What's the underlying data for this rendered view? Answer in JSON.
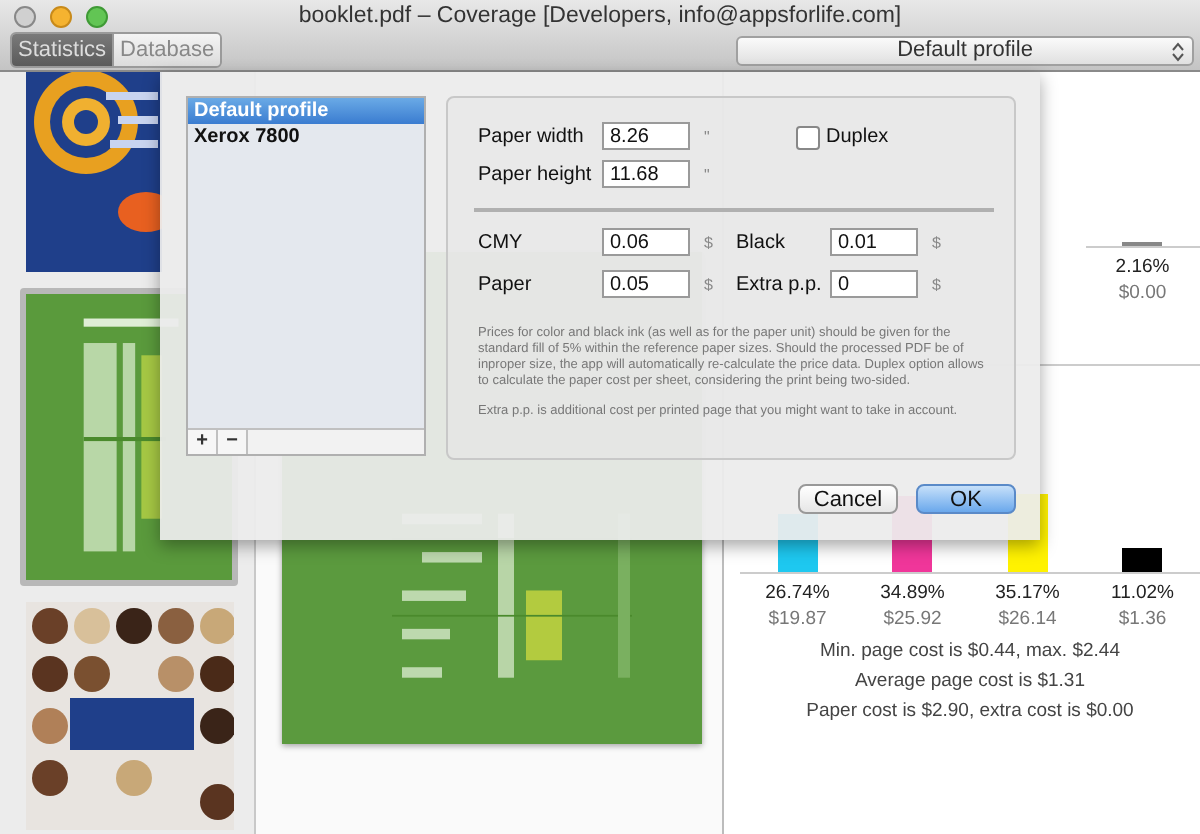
{
  "window": {
    "title": "booklet.pdf – Coverage [Developers, info@appsforlife.com]"
  },
  "view_tabs": [
    {
      "label": "Statistics",
      "selected": true
    },
    {
      "label": "Database",
      "selected": false
    }
  ],
  "profile_popup": {
    "value": "Default profile"
  },
  "page_cost_column": {
    "share": "2.16%",
    "cost": "$0.00",
    "level": 0.0216
  },
  "inks": [
    {
      "color": "#1ec8f0",
      "share": "26.74%",
      "cost": "$19.87",
      "level": 0.2674
    },
    {
      "color": "#f0369a",
      "share": "34.89%",
      "cost": "$25.92",
      "level": 0.3489
    },
    {
      "color": "#fff200",
      "share": "35.17%",
      "cost": "$26.14",
      "level": 0.3517
    },
    {
      "color": "#000000",
      "share": "11.02%",
      "cost": "$1.36",
      "level": 0.1102
    }
  ],
  "summary_lines": [
    "Min. page cost is $0.44, max. $2.44",
    "Average page cost is $1.31",
    "Paper cost is $2.90, extra cost is $0.00"
  ],
  "dialog": {
    "profiles": [
      {
        "label": "Default profile",
        "selected": true
      },
      {
        "label": "Xerox 7800",
        "selected": false
      }
    ],
    "list_buttons": [
      "+",
      "−"
    ],
    "size_fields": [
      {
        "label": "Paper width",
        "value": "8.26",
        "unit": "\""
      },
      {
        "label": "Paper height",
        "value": "11.68",
        "unit": "\""
      }
    ],
    "duplex": {
      "label": "Duplex",
      "checked": false
    },
    "price_fields": [
      {
        "label": "CMY",
        "value": "0.06",
        "unit": "$"
      },
      {
        "label": "Black",
        "value": "0.01",
        "unit": "$"
      },
      {
        "label": "Paper",
        "value": "0.05",
        "unit": "$"
      },
      {
        "label": "Extra p.p.",
        "value": "0",
        "unit": "$"
      }
    ],
    "notes": [
      "Prices for color and black ink (as well as for the paper unit) should be given for the standard fill of 5% within the reference paper sizes. Should the processed PDF be of inproper size, the app will automatically re-calculate the price data. Duplex option allows to calculate the paper cost per sheet, considering the print being two-sided.",
      "Extra p.p. is additional cost per printed page that you might want to take in account."
    ],
    "buttons": [
      {
        "label": "Cancel",
        "kind": "normal"
      },
      {
        "label": "OK",
        "kind": "default"
      }
    ]
  }
}
